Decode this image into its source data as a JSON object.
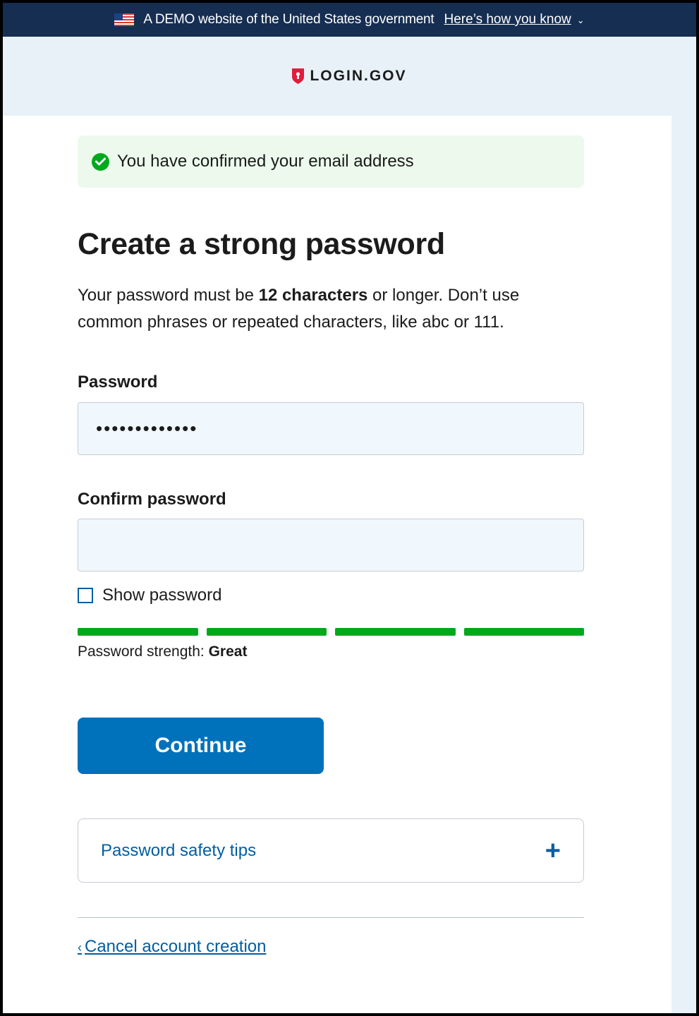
{
  "gov_banner": {
    "text": "A DEMO website of the United States government",
    "link": "Here’s how you know"
  },
  "header": {
    "logo_text": "LOGIN.GOV"
  },
  "alert": {
    "message": "You have confirmed your email address"
  },
  "page": {
    "title": "Create a strong password",
    "intro_before": "Your password must be ",
    "intro_bold": "12 characters",
    "intro_after": " or longer. Don’t use common phrases or repeated characters, like abc or 111."
  },
  "form": {
    "password_label": "Password",
    "password_value": "•••••••••••••",
    "confirm_label": "Confirm password",
    "confirm_value": "",
    "show_password_label": "Show password",
    "strength_label": "Password strength: ",
    "strength_value": "Great",
    "strength_segments_filled": 4,
    "strength_segments_total": 4,
    "continue_label": "Continue"
  },
  "accordion": {
    "label": "Password safety tips"
  },
  "footer": {
    "cancel_label": "Cancel account creation"
  },
  "colors": {
    "banner_bg": "#162e51",
    "primary": "#0071bb",
    "link": "#005ea2",
    "success": "#00a91c",
    "alert_bg": "#ecf9ec",
    "input_bg": "#f0f7fd"
  }
}
